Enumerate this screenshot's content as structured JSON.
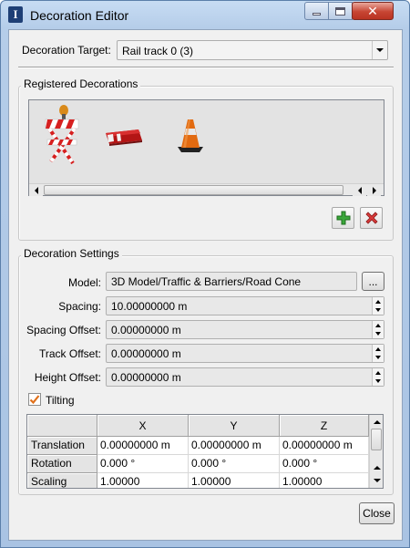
{
  "window": {
    "title": "Decoration Editor",
    "app_icon_letter": "I"
  },
  "target": {
    "label": "Decoration Target:",
    "value": "Rail track 0 (3)"
  },
  "registered": {
    "title": "Registered Decorations",
    "items": [
      "barricade-sign",
      "barrier-block",
      "traffic-cone"
    ]
  },
  "settings": {
    "title": "Decoration Settings",
    "model_label": "Model:",
    "model_value": "3D Model/Traffic & Barriers/Road Cone",
    "browse_label": "...",
    "spacing_label": "Spacing:",
    "spacing_value": "10.00000000 m",
    "spacing_offset_label": "Spacing Offset:",
    "spacing_offset_value": "0.00000000 m",
    "track_offset_label": "Track Offset:",
    "track_offset_value": "0.00000000 m",
    "height_offset_label": "Height Offset:",
    "height_offset_value": "0.00000000 m",
    "tilting_label": "Tilting",
    "tilting_checked": true
  },
  "table": {
    "columns": [
      "X",
      "Y",
      "Z"
    ],
    "rows": [
      {
        "name": "Translation",
        "values": [
          "0.00000000 m",
          "0.00000000 m",
          "0.00000000 m"
        ]
      },
      {
        "name": "Rotation",
        "values": [
          "0.000 °",
          "0.000 °",
          "0.000 °"
        ]
      },
      {
        "name": "Scaling",
        "values": [
          "1.00000",
          "1.00000",
          "1.00000"
        ]
      }
    ]
  },
  "buttons": {
    "close": "Close"
  },
  "colors": {
    "add_green": "#2f9a2f",
    "remove_red": "#cc3333",
    "check_orange": "#e0701a"
  }
}
